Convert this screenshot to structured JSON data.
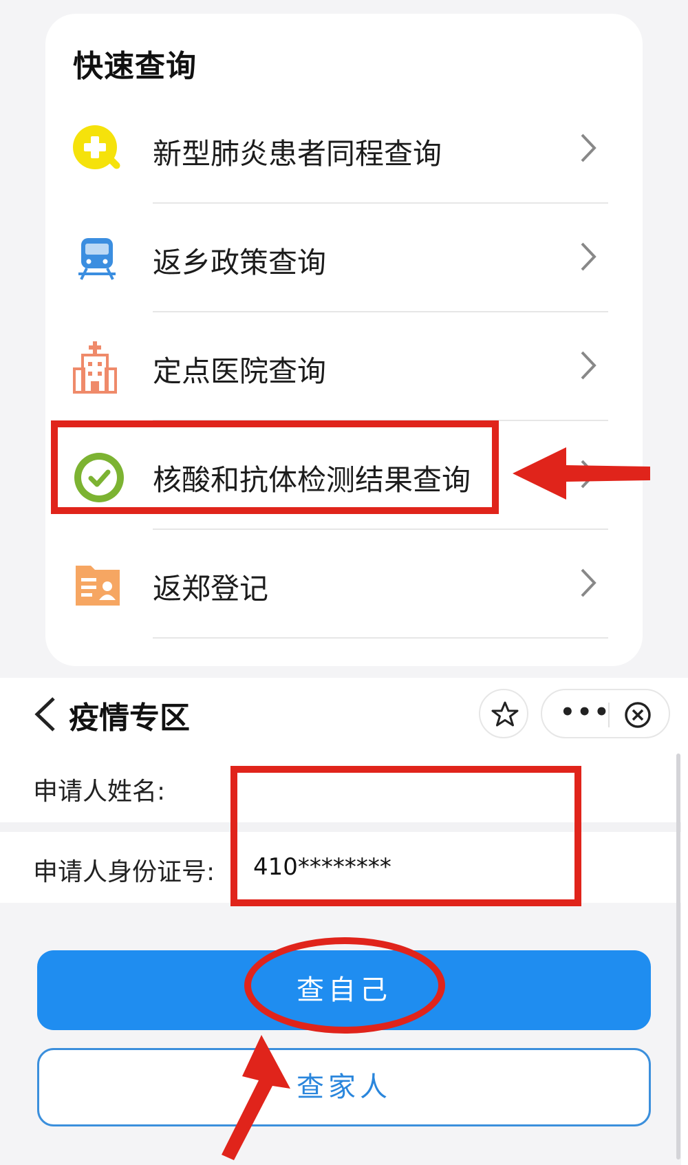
{
  "quick_query": {
    "title": "快速查询",
    "items": [
      {
        "label": "新型肺炎患者同程查询",
        "icon": "magnifier-plus-icon",
        "color": "#f5e20b"
      },
      {
        "label": "返乡政策查询",
        "icon": "train-icon",
        "color": "#3b8ee0"
      },
      {
        "label": "定点医院查询",
        "icon": "hospital-icon",
        "color": "#ef8a6a"
      },
      {
        "label": "核酸和抗体检测结果查询",
        "icon": "check-circle-icon",
        "color": "#7cb332"
      },
      {
        "label": "返郑登记",
        "icon": "id-card-icon",
        "color": "#f6a662"
      }
    ]
  },
  "nav": {
    "title": "疫情专区"
  },
  "form": {
    "name_label": "申请人姓名:",
    "name_value": "",
    "id_label": "申请人身份证号:",
    "id_value": "410********"
  },
  "buttons": {
    "self_label": "查自己",
    "family_label": "查家人"
  },
  "colors": {
    "primary": "#1f8df0",
    "annotation_red": "#e0241b"
  }
}
